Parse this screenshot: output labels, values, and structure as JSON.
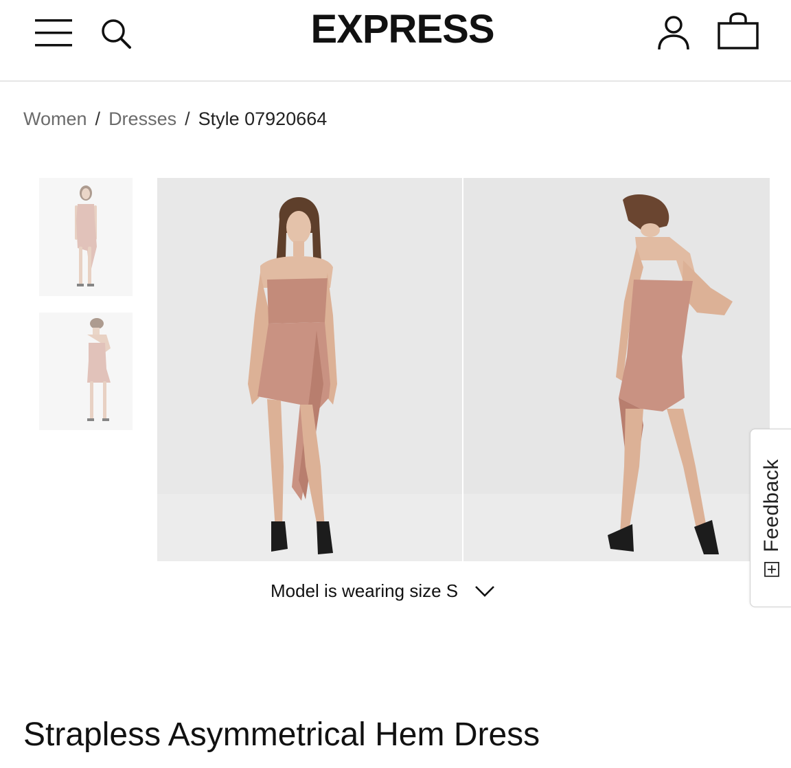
{
  "header": {
    "logo_text": "EXPRESS",
    "icons": [
      "menu-icon",
      "search-icon",
      "account-icon",
      "shopping-bag-icon"
    ]
  },
  "breadcrumb": {
    "items": [
      {
        "label": "Women"
      },
      {
        "label": "Dresses"
      }
    ],
    "current": "Style 07920664",
    "separator": "/"
  },
  "gallery": {
    "thumbnails": [
      {
        "view": "front"
      },
      {
        "view": "back"
      }
    ],
    "images": [
      {
        "view": "front"
      },
      {
        "view": "back"
      }
    ],
    "model_size_text": "Model is wearing size S",
    "dress_color": "#c99282"
  },
  "feedback": {
    "label": "Feedback"
  },
  "product": {
    "title": "Strapless Asymmetrical Hem Dress"
  }
}
